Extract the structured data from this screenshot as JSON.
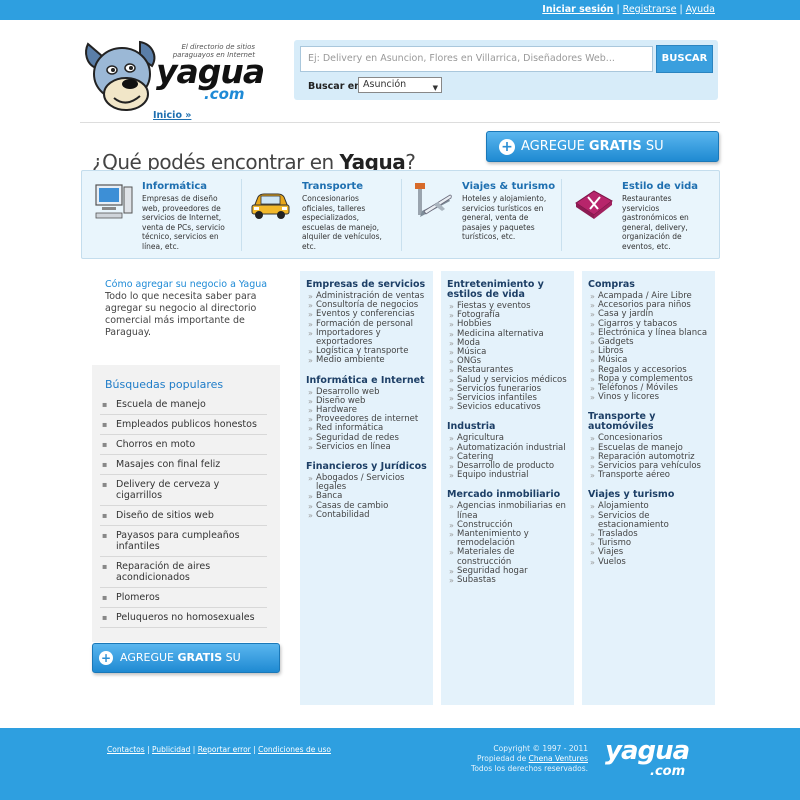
{
  "topbar": {
    "login": "Iniciar sesión",
    "register": "Registrarse",
    "help": "Ayuda",
    "separator": "|"
  },
  "header": {
    "tagline": "El directorio de sitios paraguayos en Internet",
    "logo_word": "yagua",
    "logo_com": ".com"
  },
  "search": {
    "placeholder": "Ej: Delivery en Asuncion, Flores en Villarrica, Diseñadores Web...",
    "button": "BUSCAR",
    "in_label": "Buscar en:",
    "city": "Asunción"
  },
  "breadcrumb": "Inicio »",
  "headline": {
    "prefix": "¿Qué podés encontrar en ",
    "brand": "Yagua",
    "suffix": "?"
  },
  "cta_label_normal": "AGREGUE ",
  "cta_label_bold": "GRATIS",
  "cta_label_end": " SU NEGOCIO",
  "categories": [
    {
      "title": "Informática",
      "desc": "Empresas de diseño web, proveedores de servicios de Internet, venta de PCs, servicio técnico, servicios en línea, etc.",
      "icon": "computer-icon"
    },
    {
      "title": "Transporte",
      "desc": "Concesionarios oficiales, talleres especializados, escuelas de manejo, alquiler de vehículos, etc.",
      "icon": "car-icon"
    },
    {
      "title": "Viajes & turismo",
      "desc": "Hoteles y alojamiento, servicios turísticos en general, venta de pasajes y paquetes turísticos, etc.",
      "icon": "airplane-icon"
    },
    {
      "title": "Estilo de vida",
      "desc": "Restaurantes yservicios gastronómicos en general, delivery, organización de eventos, etc.",
      "icon": "restaurant-icon"
    }
  ],
  "howto": {
    "title": "Cómo agregar su negocio a Yagua",
    "text": "Todo lo que necesita saber para agregar su negocio al directorio comercial más importante de Paraguay."
  },
  "popular": {
    "title": "Búsquedas populares",
    "items": [
      "Escuela de manejo",
      "Empleados publicos honestos",
      "Chorros en moto",
      "Masajes con final feliz",
      "Delivery de cerveza y cigarrillos",
      "Diseño de sitios web",
      "Payasos para cumpleaños infantiles",
      "Reparación de aires acondicionados",
      "Plomeros",
      "Peluqueros no homosexuales"
    ]
  },
  "directory": [
    [
      {
        "title": "Empresas de servicios",
        "items": [
          "Administración de ventas",
          "Consultoría de negocios",
          "Eventos y conferencias",
          "Formación de personal",
          "Importadores y exportadores",
          "Logística y transporte",
          "Medio ambiente"
        ]
      },
      {
        "title": "Informática e Internet",
        "items": [
          "Desarrollo web",
          "Diseño web",
          "Hardware",
          "Proveedores de internet",
          "Red informática",
          "Seguridad de redes",
          "Servicios en línea"
        ]
      },
      {
        "title": "Financieros y Jurídicos",
        "items": [
          "Abogados / Servicios legales",
          "Banca",
          "Casas de cambio",
          "Contabilidad"
        ]
      }
    ],
    [
      {
        "title": "Entretenimiento y estilos de vida",
        "items": [
          "Fiestas y eventos",
          "Fotografía",
          "Hobbies",
          "Medicina alternativa",
          "Moda",
          "Música",
          "ONGs",
          "Restaurantes",
          "Salud y servicios médicos",
          "Servicios funerarios",
          "Servicios infantiles",
          "Sevicios educativos"
        ]
      },
      {
        "title": "Industria",
        "items": [
          "Agricultura",
          "Automatización industrial",
          "Catering",
          "Desarrollo de producto",
          "Equipo industrial"
        ]
      },
      {
        "title": "Mercado inmobiliario",
        "items": [
          "Agencias inmobiliarias en línea",
          "Construcción",
          "Mantenimiento y remodelación",
          "Materiales de construcción",
          "Seguridad hogar",
          "Subastas"
        ]
      }
    ],
    [
      {
        "title": "Compras",
        "items": [
          "Acampada / Aire Libre",
          "Accesorios para niños",
          "Casa y jardín",
          "Cigarros y tabacos",
          "Electrónica y línea blanca",
          "Gadgets",
          "Libros",
          "Música",
          "Regalos y accesorios",
          "Ropa y complementos",
          "Teléfonos / Móviles",
          "Vinos y licores"
        ]
      },
      {
        "title": "Transporte y automóviles",
        "items": [
          "Concesionarios",
          "Escuelas de manejo",
          "Reparación automotriz",
          "Servicios para vehículos",
          "Transporte aéreo"
        ]
      },
      {
        "title": "Viajes y turismo",
        "items": [
          "Alojamiento",
          "Servicios de estacionamiento",
          "Traslados",
          "Turismo",
          "Viajes",
          "Vuelos"
        ]
      }
    ]
  ],
  "footer": {
    "links": [
      "Contactos",
      "Publicidad",
      "Reportar error",
      "Condiciones de uso"
    ],
    "copyright": "Copyright © 1997 - 2011",
    "owner_prefix": "Propiedad de ",
    "owner": "Chena Ventures",
    "rights": "Todos los derechos reservados.",
    "logo_word": "yagua",
    "logo_com": ".com"
  }
}
